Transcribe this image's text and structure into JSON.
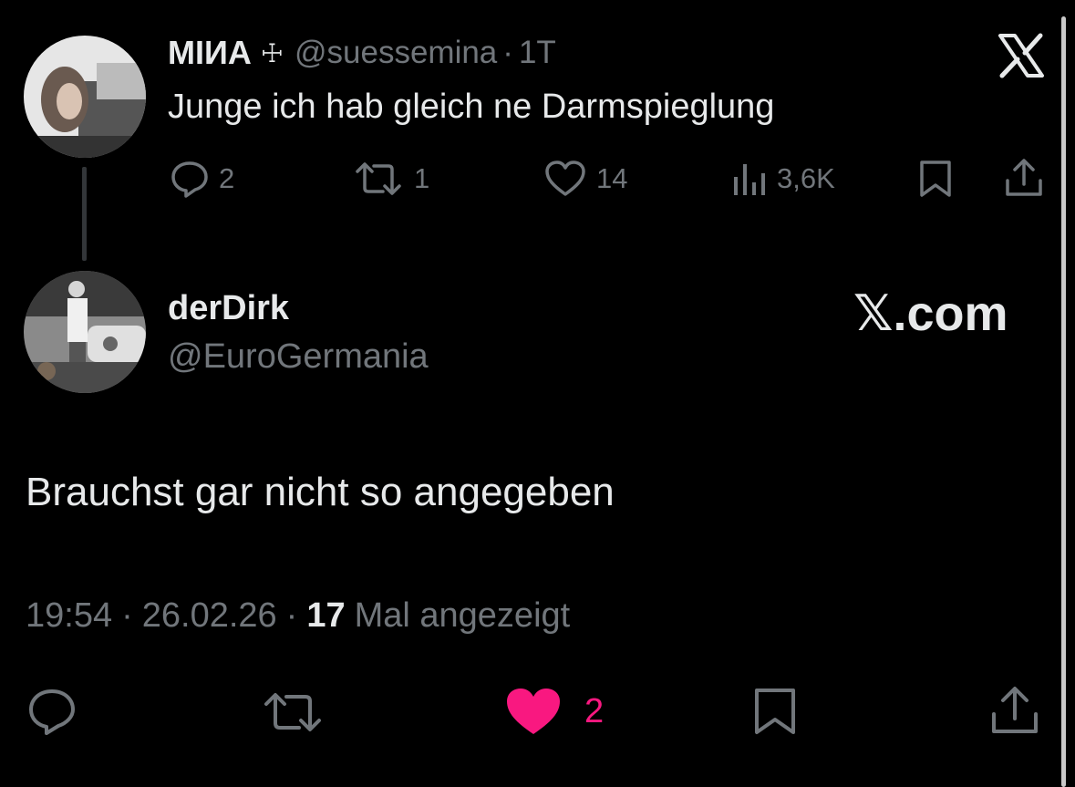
{
  "quoted_tweet": {
    "display_name": "МIИA",
    "cross_glyph": "☩",
    "handle": "@suessemina",
    "separator": "·",
    "age": "1T",
    "text": "Junge ich hab gleich ne Darmspieglung",
    "stats": {
      "replies": "2",
      "retweets": "1",
      "likes": "14",
      "views": "3,6K"
    }
  },
  "reply_tweet": {
    "display_name": "derDirk",
    "handle": "@EuroGermania",
    "text": "Brauchst gar nicht so angegeben",
    "time": "19:54",
    "sep1": "·",
    "date": "26.02.26",
    "sep2": "·",
    "view_count": "17",
    "view_label": "Mal angezeigt",
    "likes": "2"
  },
  "branding": {
    "x_logo": "𝕏",
    "watermark": "𝕏.com"
  },
  "colors": {
    "background": "#000000",
    "text": "#e7e9ea",
    "muted": "#71767b",
    "like": "#f91880"
  },
  "icons": {
    "reply": "speech-bubble-icon",
    "retweet": "retweet-icon",
    "like": "heart-icon",
    "views": "bar-chart-icon",
    "bookmark": "bookmark-icon",
    "share": "share-icon"
  }
}
